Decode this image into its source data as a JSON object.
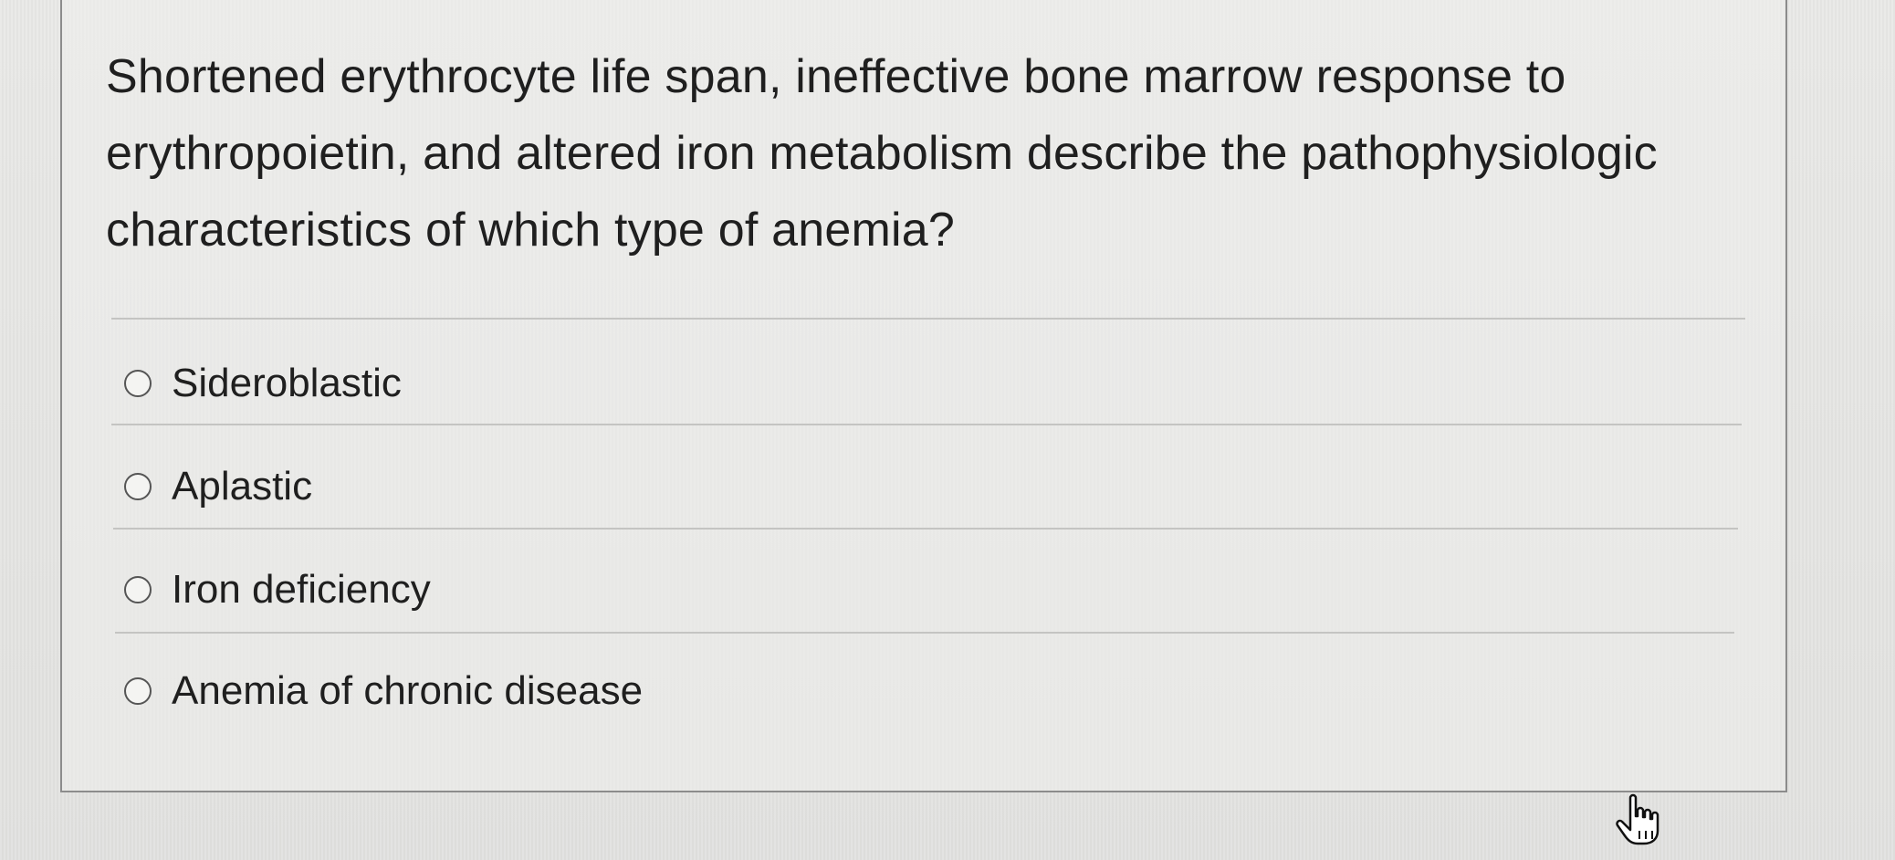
{
  "question": {
    "text": "Shortened erythrocyte life span, ineffective bone marrow response to erythropoietin, and altered iron metabolism describe the pathophysiologic characteristics of which type of anemia?"
  },
  "options": [
    {
      "label": "Sideroblastic",
      "selected": false
    },
    {
      "label": "Aplastic",
      "selected": false
    },
    {
      "label": "Iron deficiency",
      "selected": false
    },
    {
      "label": "Anemia of chronic disease",
      "selected": false
    }
  ],
  "cursor": {
    "icon": "hand-pointer-icon"
  }
}
